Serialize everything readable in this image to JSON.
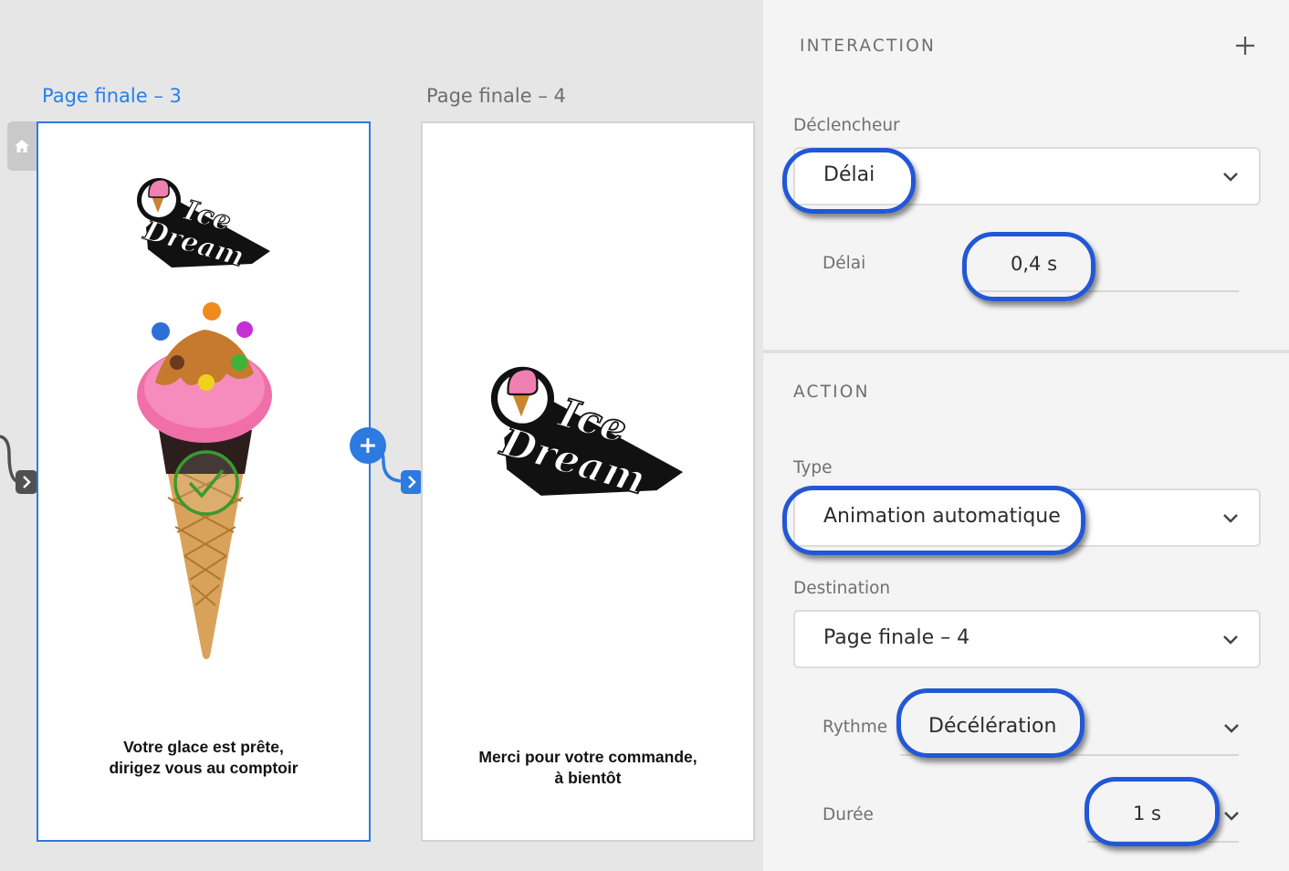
{
  "canvas": {
    "artboard_1": {
      "title": "Page finale – 3",
      "logo": [
        "Ice",
        "Dream"
      ],
      "message_line1": "Votre glace est prête,",
      "message_line2": "dirigez vous au comptoir"
    },
    "artboard_2": {
      "title": "Page finale – 4",
      "logo": [
        "Ice",
        "Dream"
      ],
      "message_line1": "Merci pour votre commande,",
      "message_line2": "à bientôt"
    }
  },
  "inspector": {
    "interaction": {
      "title": "INTERACTION",
      "trigger_label": "Déclencheur",
      "trigger_value": "Délai",
      "delay_label": "Délai",
      "delay_value": "0,4 s"
    },
    "action": {
      "title": "ACTION",
      "type_label": "Type",
      "type_value": "Animation automatique",
      "destination_label": "Destination",
      "destination_value": "Page finale – 4",
      "easing_label": "Rythme",
      "easing_value": "Décélération",
      "duration_label": "Durée",
      "duration_value": "1 s"
    }
  },
  "colors": {
    "accent": "#2680eb",
    "highlight": "#2257d6",
    "panel_bg": "#f4f4f4",
    "canvas_bg": "#e6e6e6"
  }
}
